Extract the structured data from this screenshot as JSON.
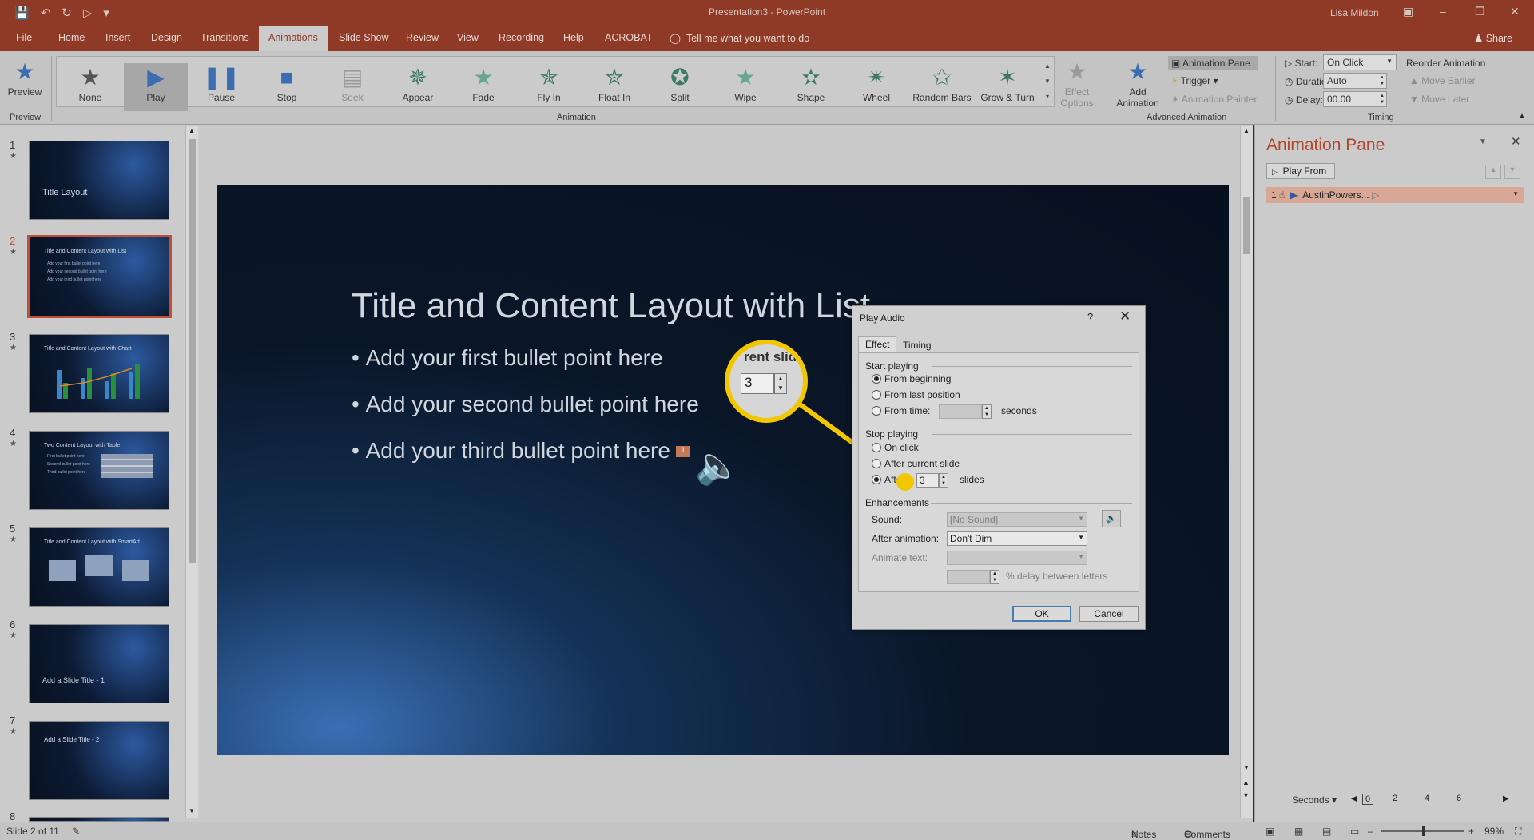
{
  "window": {
    "title": "Presentation3  -  PowerPoint",
    "user": "Lisa Mildon"
  },
  "tabs": [
    "File",
    "Home",
    "Insert",
    "Design",
    "Transitions",
    "Animations",
    "Slide Show",
    "Review",
    "View",
    "Recording",
    "Help",
    "ACROBAT"
  ],
  "active_tab": "Animations",
  "tell_me": "Tell me what you want to do",
  "share": "Share",
  "ribbon": {
    "preview": {
      "label": "Preview",
      "group": "Preview"
    },
    "animation_group": "Animation",
    "animations": [
      {
        "label": "None",
        "icon": "star-outline-icon"
      },
      {
        "label": "Play",
        "icon": "play-icon"
      },
      {
        "label": "Pause",
        "icon": "pause-icon"
      },
      {
        "label": "Stop",
        "icon": "stop-icon"
      },
      {
        "label": "Seek",
        "icon": "seek-icon"
      },
      {
        "label": "Appear",
        "icon": "star-icon"
      },
      {
        "label": "Fade",
        "icon": "star-icon"
      },
      {
        "label": "Fly In",
        "icon": "star-icon"
      },
      {
        "label": "Float In",
        "icon": "star-icon"
      },
      {
        "label": "Split",
        "icon": "star-icon"
      },
      {
        "label": "Wipe",
        "icon": "star-icon"
      },
      {
        "label": "Shape",
        "icon": "star-icon"
      },
      {
        "label": "Wheel",
        "icon": "star-icon"
      },
      {
        "label": "Random Bars",
        "icon": "star-icon"
      },
      {
        "label": "Grow & Turn",
        "icon": "star-icon"
      }
    ],
    "effect_options": {
      "line1": "Effect",
      "line2": "Options"
    },
    "add_animation": {
      "line1": "Add",
      "line2": "Animation"
    },
    "animation_pane": "Animation Pane",
    "trigger": "Trigger",
    "animation_painter": "Animation Painter",
    "advanced_group": "Advanced Animation",
    "timing": {
      "start_label": "Start:",
      "start_value": "On Click",
      "duration_label": "Duration:",
      "duration_value": "Auto",
      "delay_label": "Delay:",
      "delay_value": "00.00",
      "reorder": "Reorder Animation",
      "move_earlier": "Move Earlier",
      "move_later": "Move Later",
      "group": "Timing"
    }
  },
  "thumbnails": [
    {
      "num": "1",
      "title": "Title Layout",
      "big": true
    },
    {
      "num": "2",
      "title": "Title and Content Layout with List",
      "lines": [
        "Add your first bullet point here",
        "Add your second bullet point here",
        "Add your third bullet point here"
      ]
    },
    {
      "num": "3",
      "title": "Title and Content Layout with Chart"
    },
    {
      "num": "4",
      "title": "Two Content Layout with Table",
      "lines": [
        "First bullet point here",
        "Second bullet point here",
        "Third bullet point here"
      ]
    },
    {
      "num": "5",
      "title": "Title and Content Layout with SmartArt"
    },
    {
      "num": "6",
      "title": "Add a Slide Title - 1",
      "big": true
    },
    {
      "num": "7",
      "title": "Add a Slide Title - 2"
    },
    {
      "num": "8",
      "title": ""
    }
  ],
  "slide": {
    "title": "Title and Content Layout with List",
    "bullets": [
      "Add your first bullet point here",
      "Add your second bullet point here",
      "Add your third bullet point here"
    ],
    "badge": "1"
  },
  "dialog": {
    "title": "Play Audio",
    "help": "?",
    "tabs": [
      "Effect",
      "Timing"
    ],
    "start_playing": "Start playing",
    "from_beginning": "From beginning",
    "from_last": "From last position",
    "from_time": "From time:",
    "seconds": "seconds",
    "stop_playing": "Stop playing",
    "on_click": "On click",
    "after_current": "After current slide",
    "after": "After:",
    "after_value": "3",
    "slides": "slides",
    "enhancements": "Enhancements",
    "sound_label": "Sound:",
    "sound_value": "[No Sound]",
    "after_animation_label": "After animation:",
    "after_animation_value": "Don't Dim",
    "animate_text_label": "Animate text:",
    "delay_letters": "% delay between letters",
    "ok": "OK",
    "cancel": "Cancel"
  },
  "magnifier": {
    "partial_text": "rent slid",
    "value": "3"
  },
  "animation_pane": {
    "title": "Animation Pane",
    "play_from": "Play From",
    "item_number": "1",
    "item_name": "AustinPowers...",
    "seconds": "Seconds",
    "scale": [
      "0",
      "2",
      "4",
      "6"
    ]
  },
  "status": {
    "slide_info": "Slide 2 of 11",
    "notes": "Notes",
    "comments": "Comments",
    "zoom": "99%"
  }
}
